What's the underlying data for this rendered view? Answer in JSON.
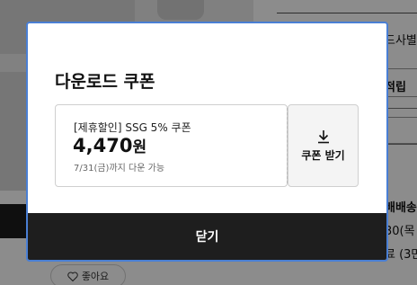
{
  "background": {
    "right_text_1": "드사별",
    "right_text_2": "적립",
    "right_text_3": "배배송",
    "right_text_4": "30(목",
    "right_text_5": "료 (3만",
    "like_label": "좋아요",
    "like_icon": "heart-outline-icon"
  },
  "modal": {
    "title": "다운로드 쿠폰",
    "coupon": {
      "name": "[제휴할인] SSG 5% 쿠폰",
      "amount": "4,470",
      "amount_unit": "원",
      "deadline": "7/31(금)까지 다운 가능",
      "download_label": "쿠폰 받기",
      "download_icon": "download-icon"
    },
    "close_label": "닫기"
  },
  "colors": {
    "modal_border": "#4a7fd4",
    "close_bar": "#1e1e1e",
    "overlay": "rgba(0,0,0,0.45)"
  }
}
